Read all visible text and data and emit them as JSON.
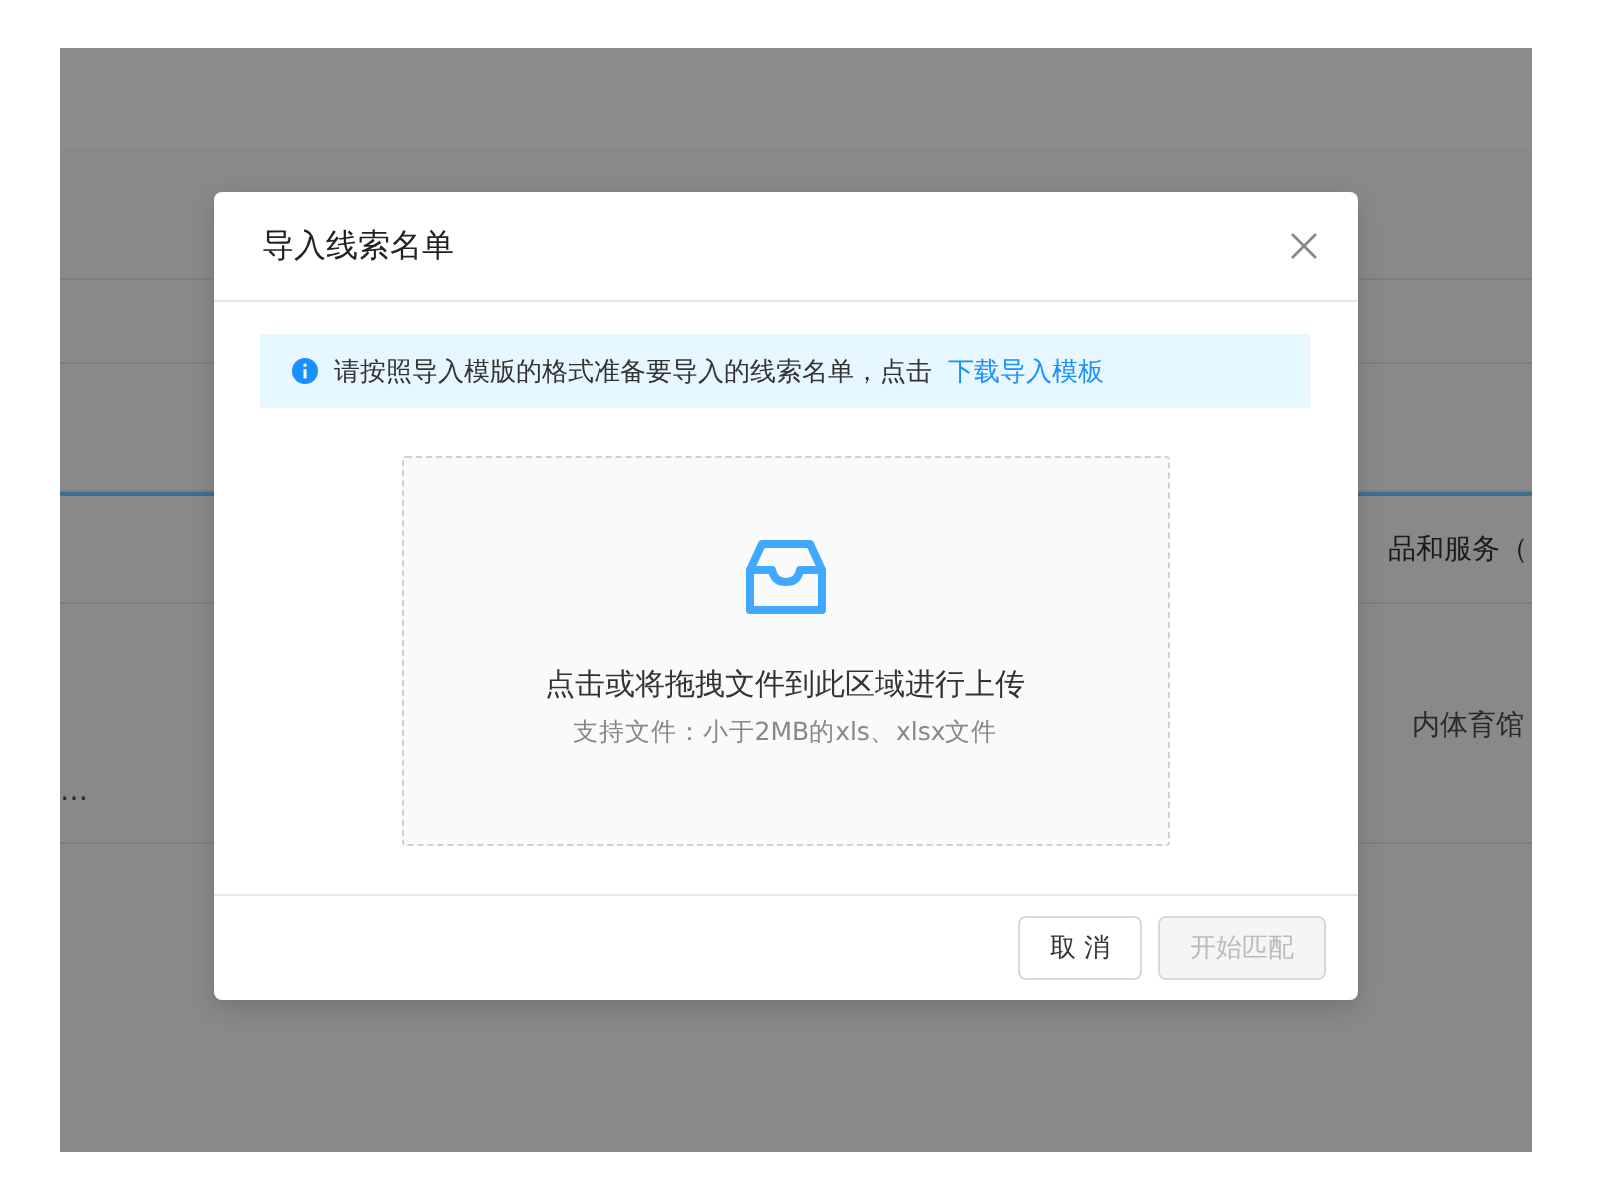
{
  "background_table": {
    "header_right": "品和服务（",
    "cell_right": "内体育馆",
    "cell_left": "…"
  },
  "dialog": {
    "title": "导入线索名单",
    "alert": {
      "text": "请按照导入模版的格式准备要导入的线索名单，点击",
      "link": "下载导入模板"
    },
    "upload": {
      "hint": "点击或将拖拽文件到此区域进行上传",
      "subhint": "支持文件：小于2MB的xls、xlsx文件"
    },
    "buttons": [
      {
        "label": "取 消",
        "disabled": false
      },
      {
        "label": "开始匹配",
        "disabled": true
      }
    ]
  }
}
